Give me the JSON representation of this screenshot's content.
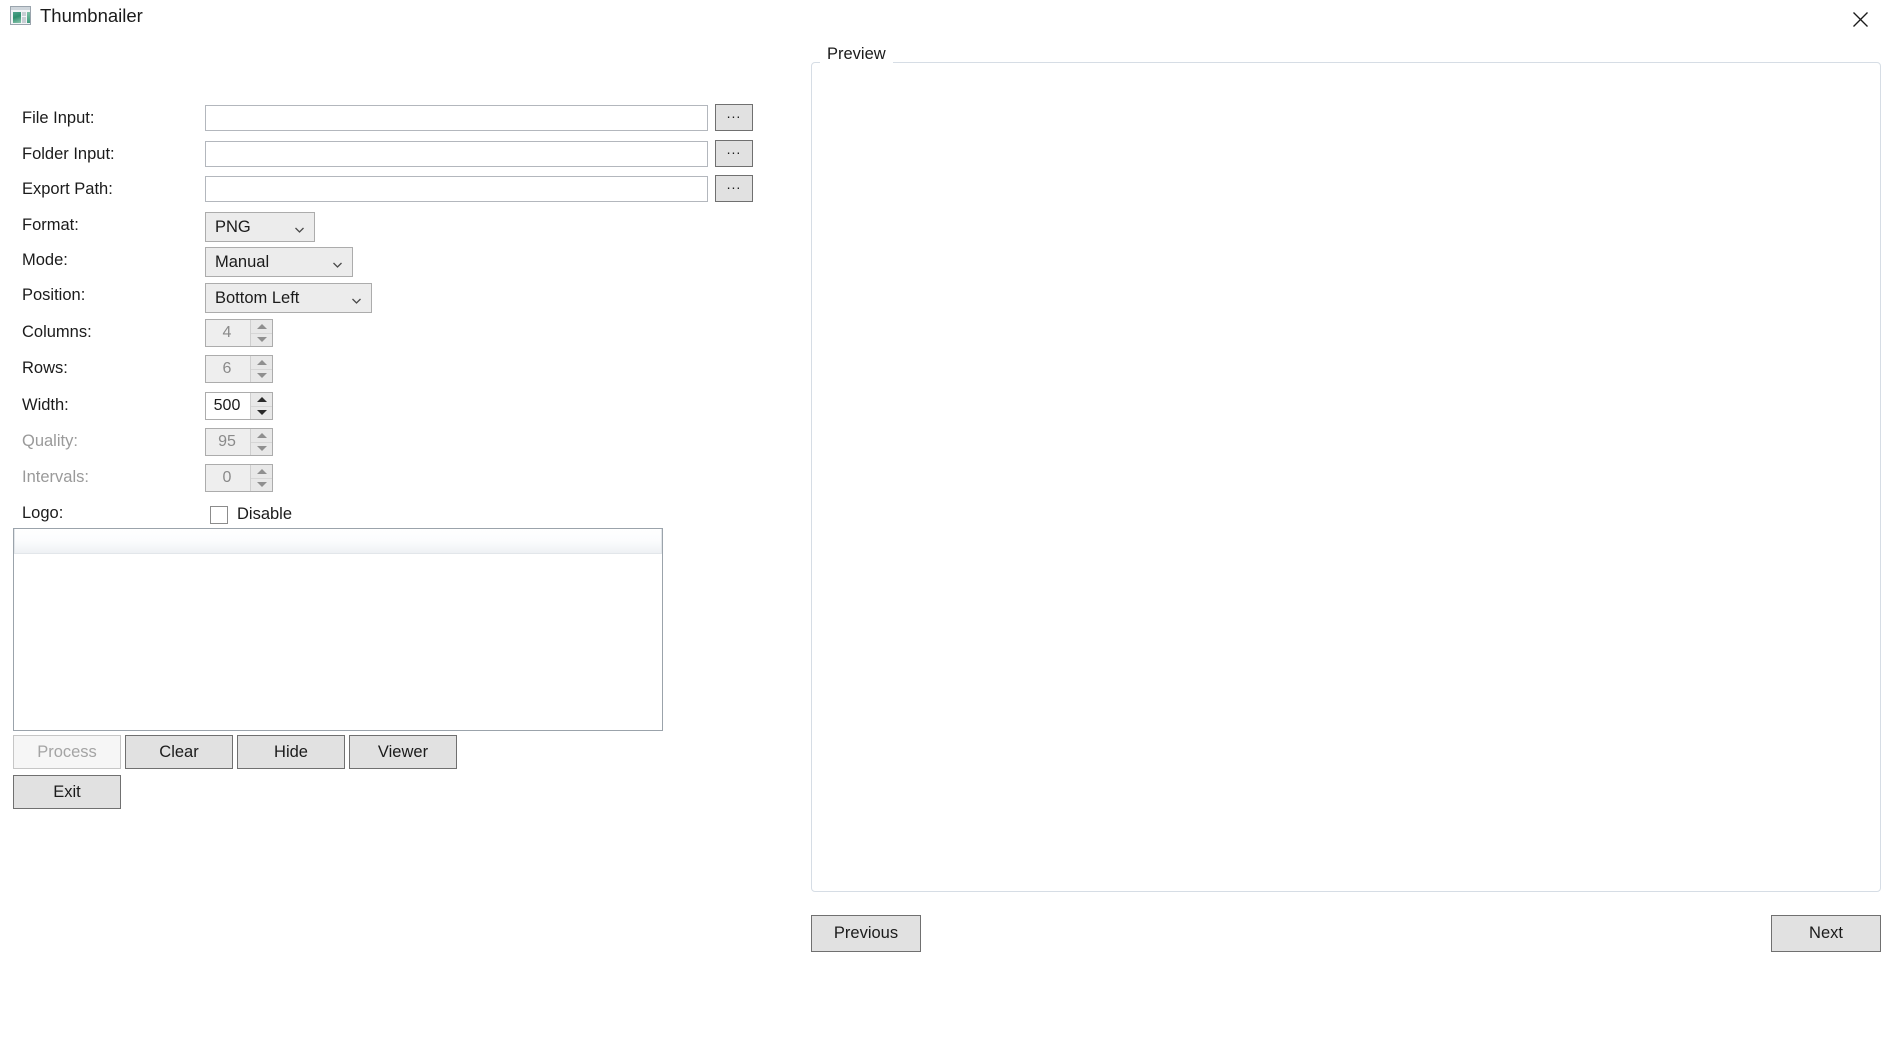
{
  "window": {
    "title": "Thumbnailer",
    "icon": "thumbnail-grid-icon",
    "close_label": "✕"
  },
  "form": {
    "rows": [
      {
        "label": "File Input:",
        "type": "text",
        "value": "",
        "placeholder": "",
        "disabled": false,
        "browse_label": "..."
      },
      {
        "label": "Folder Input:",
        "type": "text",
        "value": "",
        "placeholder": "",
        "disabled": false,
        "browse_label": "..."
      },
      {
        "label": "Export Path:",
        "type": "text",
        "value": "",
        "placeholder": "",
        "disabled": false,
        "browse_label": "..."
      },
      {
        "label": "Format:",
        "type": "combo",
        "value": "PNG",
        "disabled": false
      },
      {
        "label": "Mode:",
        "type": "combo",
        "value": "Manual",
        "disabled": false
      },
      {
        "label": "Position:",
        "type": "combo",
        "value": "Bottom Left",
        "disabled": false
      },
      {
        "label": "Columns:",
        "type": "spin",
        "value": "4",
        "disabled": false
      },
      {
        "label": "Rows:",
        "type": "spin",
        "value": "6",
        "disabled": false
      },
      {
        "label": "Width:",
        "type": "spin",
        "value": "500",
        "disabled": false
      },
      {
        "label": "Quality:",
        "type": "spin",
        "value": "95",
        "disabled": true
      },
      {
        "label": "Intervals:",
        "type": "spin",
        "value": "0",
        "disabled": true
      },
      {
        "label": "Logo:",
        "type": "check",
        "value": "Disable",
        "checked": false,
        "disabled": false
      }
    ],
    "labels": {
      "file_input": "File Input:",
      "folder_input": "Folder Input:",
      "export_path": "Export Path:",
      "format": "Format:",
      "mode": "Mode:",
      "position": "Position:",
      "columns": "Columns:",
      "rows": "Rows:",
      "width": "Width:",
      "quality": "Quality:",
      "intervals": "Intervals:",
      "logo": "Logo:"
    },
    "values": {
      "file_input": "",
      "folder_input": "",
      "export_path": "",
      "format": "PNG",
      "mode": "Manual",
      "position": "Bottom Left",
      "columns": "4",
      "rows": "6",
      "width": "500",
      "quality": "95",
      "intervals": "0",
      "logo_checkbox": "Disable"
    },
    "browse_label": "..."
  },
  "filelist": {
    "column_header": "",
    "items": []
  },
  "actions": {
    "process": "Process",
    "clear": "Clear",
    "hide": "Hide",
    "viewer": "Viewer",
    "exit": "Exit",
    "process_enabled": false
  },
  "preview": {
    "legend": "Preview",
    "previous": "Previous",
    "next": "Next"
  },
  "colors": {
    "window_bg": "#ffffff",
    "button_face": "#e1e1e1",
    "button_border": "#707070",
    "combo_face": "#ececec",
    "disabled_text": "#9a9a9a",
    "text": "#1b1b1b",
    "groupbox_border": "#d6dde5"
  }
}
